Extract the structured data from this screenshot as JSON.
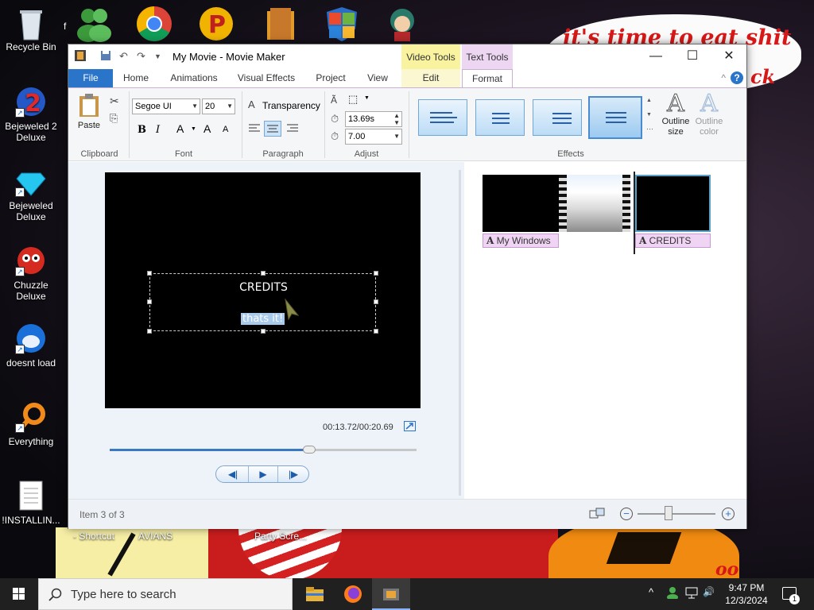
{
  "desktop": {
    "wallpaper_text": "it's time to eat shit",
    "wallpaper_text_fragment": "ck",
    "wallpaper_fragment_bottom": "oo",
    "icons": [
      {
        "label": "Recycle Bin"
      },
      {
        "label": "Bejeweled 2 Deluxe"
      },
      {
        "label": "Bejeweled Deluxe"
      },
      {
        "label": "Chuzzle Deluxe"
      },
      {
        "label": "doesnt load"
      },
      {
        "label": "Everything"
      },
      {
        "label": "!INSTALLIN..."
      }
    ],
    "partial_labels": [
      "- Shortcut",
      "AVIANS",
      "Party Scre..."
    ],
    "glyphs": {
      "bejeweled2_badge": "2",
      "top_fragment": "f"
    }
  },
  "window": {
    "title": "My Movie - Movie Maker",
    "contextual_tabs": {
      "video_tools": "Video Tools",
      "text_tools": "Text Tools"
    },
    "controls": {
      "minimize": "—",
      "maximize": "☐",
      "close": "✕"
    },
    "help": "?",
    "ribbon_collapse": "^",
    "tabs": [
      "File",
      "Home",
      "Animations",
      "Visual Effects",
      "Project",
      "View",
      "Edit",
      "Format"
    ],
    "active_tab": "Format",
    "ribbon": {
      "clipboard": {
        "paste": "Paste",
        "label": "Clipboard"
      },
      "font": {
        "family": "Segoe UI",
        "size": "20",
        "bold": "B",
        "italic": "I",
        "color": "A",
        "grow": "A",
        "shrink": "A",
        "label": "Font"
      },
      "paragraph": {
        "transparency": "Transparency",
        "label": "Paragraph"
      },
      "adjust": {
        "start_time": "13.69s",
        "duration": "7.00",
        "label": "Adjust"
      },
      "effects": {
        "outline_size": "Outline size",
        "outline_color": "Outline color",
        "label": "Effects",
        "selected_index": 3
      },
      "glyphs": {
        "transparency_icon": "A",
        "outline_icon": "A",
        "scroll_up": "▲",
        "scroll_down": "▼",
        "gallery_more": "⋯"
      }
    },
    "preview": {
      "title_text": "CREDITS",
      "sub_text": "thats it!",
      "time_display": "00:13.72/00:20.69",
      "seek_fraction": 0.65
    },
    "transport": {
      "prev": "◀|",
      "play": "▶",
      "next": "|▶"
    },
    "storyboard": {
      "captions": [
        {
          "icon": "A",
          "text": "My Windows"
        },
        {
          "icon": "A",
          "text": "CREDITS"
        }
      ]
    },
    "status": {
      "item_text": "Item 3 of 3",
      "zoom_out": "−",
      "zoom_in": "+",
      "zoom_fraction": 0.4
    }
  },
  "taskbar": {
    "search_placeholder": "Type here to search",
    "time": "9:47 PM",
    "date": "12/3/2024",
    "notification_count": "1",
    "tray": {
      "chevron": "^",
      "speaker": "🔊"
    }
  },
  "colors": {
    "accent": "#2a75c9",
    "video_tools": "#f9f3a0",
    "text_tools": "#ecd6f2",
    "wallpaper_text": "#d81818"
  }
}
